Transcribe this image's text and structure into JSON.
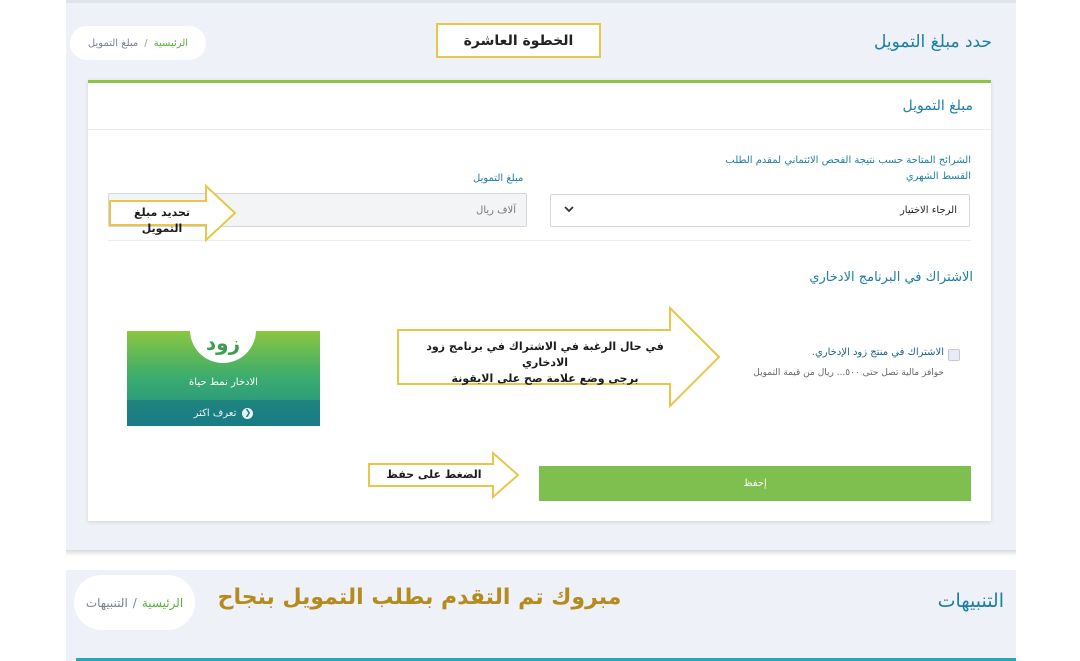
{
  "header": {
    "page_title": "حدد مبلغ التمويل",
    "breadcrumb_home": "الرئيسية",
    "breadcrumb_sep": "/",
    "breadcrumb_current": "مبلغ التمويل",
    "step_label": "الخطوة العاشرة"
  },
  "card": {
    "title": "مبلغ التمويل",
    "tier_label_line1": "الشرائح المتاحة حسب نتيجة الفحص الائتماني لمقدم الطلب",
    "tier_label_line2": "القسط الشهري",
    "tier_select_value": "الرجاء الاختيار",
    "amount_label": "مبلغ التمويل",
    "amount_placeholder": "آلاف ريال",
    "savings_section_title": "الاشتراك في البرنامج الادخاري",
    "savings_checkbox_label": "الاشتراك في منتج زود الإدخاري.",
    "savings_incentive": "حوافز مالية تصل حتى ٥٠٠... ريال من قيمة التمويل",
    "save_button": "إحفظ"
  },
  "zood_banner": {
    "logo_text": "زود",
    "tagline": "الادخار نمط حياة",
    "more_link": "تعرف اكثر"
  },
  "annotations": {
    "set_amount": "تحديد مبلغ التمويل",
    "savings_line1": "في حال الرغبة في الاشتراك في برنامج زود الادخاري",
    "savings_line2": "برجى وضع علامة صح على الايقونة",
    "press_save": "الضغط على حفظ"
  },
  "alerts": {
    "title": "التنبيهات",
    "congrats": "مبروك تم التقدم بطلب التمويل بنجاح",
    "breadcrumb_home": "الرئيسية",
    "breadcrumb_sep": "/",
    "breadcrumb_current": "التنبيهات"
  },
  "colors": {
    "brand_blue": "#1d7ea4",
    "accent_green": "#7fbf4f",
    "annotation_yellow": "#e7c64a",
    "congrats_gold": "#b58b1e"
  }
}
